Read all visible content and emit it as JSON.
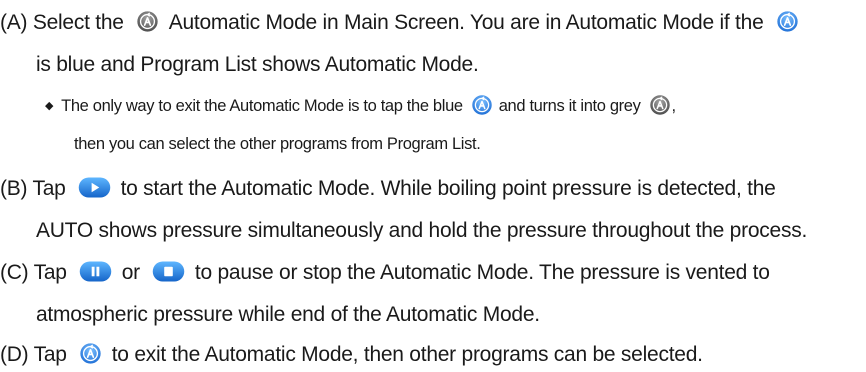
{
  "paragraphs": {
    "a1": {
      "prefix": "(A) Select the",
      "middle": "Automatic Mode in Main Screen. You are in Automatic Mode if the"
    },
    "a2": "is blue and Program List shows Automatic Mode.",
    "bullet": {
      "prefix": "The only way to exit the Automatic Mode is to tap the blue",
      "middle": "and turns it into grey",
      "suffix": ",",
      "continuation": "then you can select the other programs from Program List."
    },
    "b1": {
      "prefix": "(B) Tap",
      "suffix": "to start the Automatic Mode. While boiling point pressure is detected, the"
    },
    "b2": "AUTO shows pressure simultaneously and hold the pressure throughout the process.",
    "c1": {
      "prefix": "(C) Tap",
      "middle": "or",
      "suffix": "to pause or stop the Automatic Mode. The pressure is vented to"
    },
    "c2": "atmospheric pressure while end of the Automatic Mode.",
    "d1": {
      "prefix": "(D) Tap",
      "suffix": "to exit the Automatic Mode, then other programs can be selected."
    }
  },
  "icons": {
    "auto_grey": "auto-mode-grey-icon",
    "auto_blue": "auto-mode-blue-icon",
    "play": "play-button-icon",
    "pause": "pause-button-icon",
    "stop": "stop-button-icon"
  },
  "colors": {
    "text": "#1a1a1a",
    "blue": "#2a83e6",
    "grey": "#5e5e5e"
  }
}
